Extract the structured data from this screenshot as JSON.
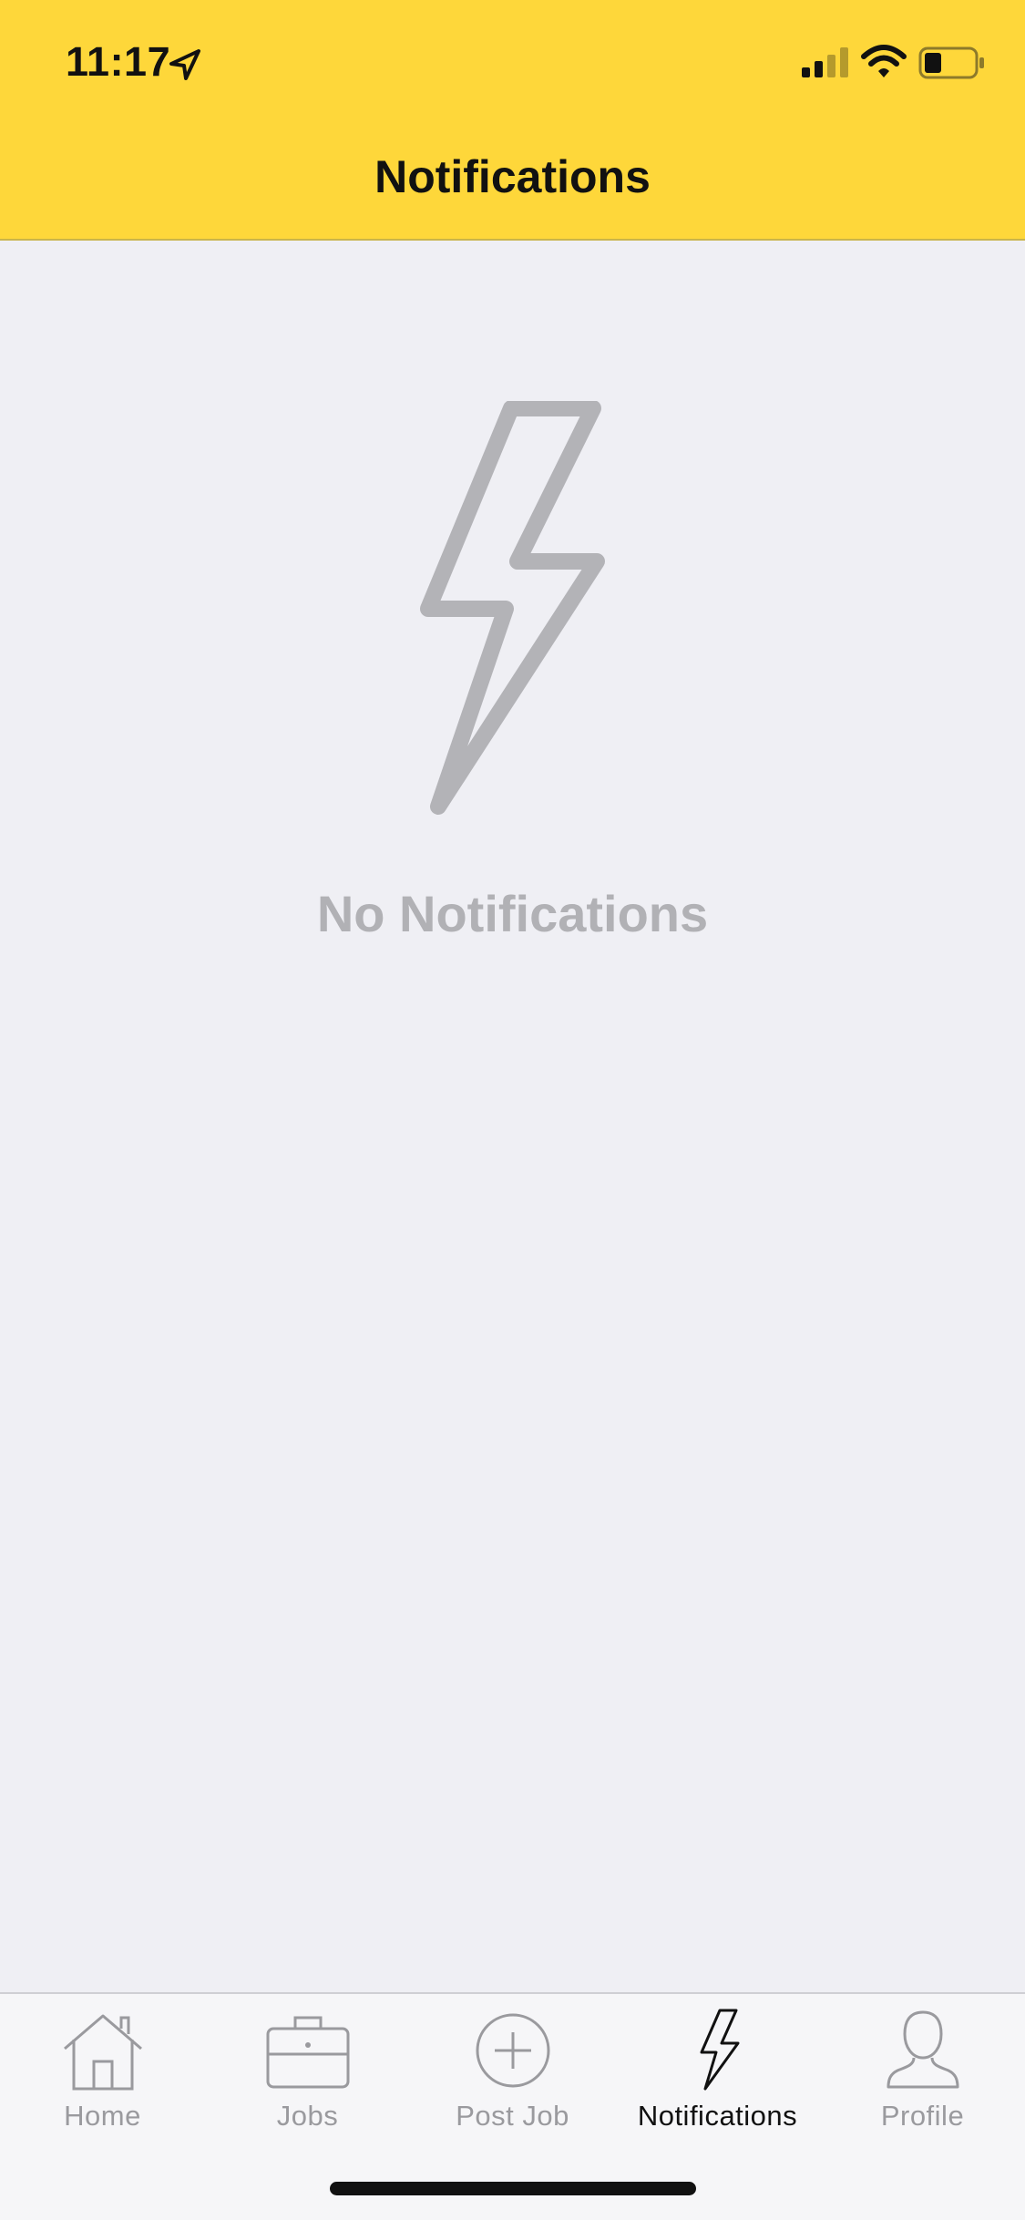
{
  "status_bar": {
    "time": "11:17",
    "icons": [
      "location-arrow-icon",
      "cellular-signal-icon",
      "wifi-icon",
      "battery-icon"
    ]
  },
  "header": {
    "title": "Notifications",
    "background_color": "#fed73a"
  },
  "empty_state": {
    "icon": "lightning-bolt-icon",
    "message": "No Notifications",
    "color": "#b1b1b5"
  },
  "tab_bar": {
    "active_tab": "Notifications",
    "tabs": [
      {
        "label": "Home",
        "icon": "house-icon"
      },
      {
        "label": "Jobs",
        "icon": "briefcase-icon"
      },
      {
        "label": "Post Job",
        "icon": "plus-circle-icon"
      },
      {
        "label": "Notifications",
        "icon": "lightning-bolt-icon"
      },
      {
        "label": "Profile",
        "icon": "person-icon"
      }
    ]
  }
}
